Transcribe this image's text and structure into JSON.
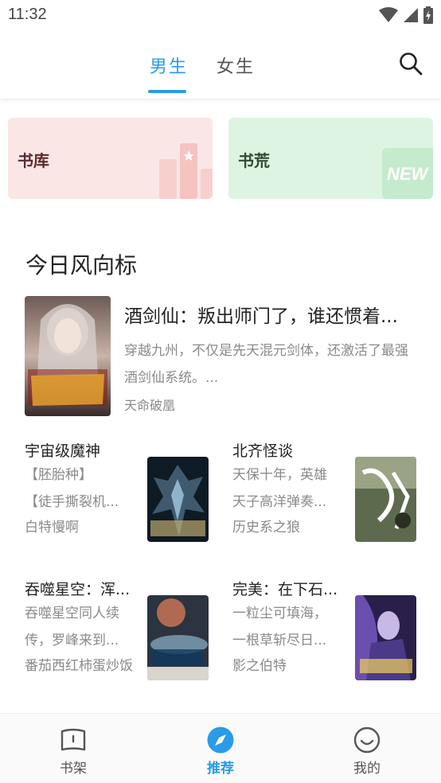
{
  "status": {
    "time": "11:32"
  },
  "nav": {
    "tab_male": "男生",
    "tab_female": "女生"
  },
  "banners": {
    "library": "书库",
    "shortage": "书荒"
  },
  "section": {
    "title": "今日风向标"
  },
  "featured": {
    "title": "酒剑仙：叛出师门了，谁还惯着...",
    "desc": "穿越九州，不仅是先天混元剑体，还激活了最强酒剑仙系统。...",
    "author": "天命破凰"
  },
  "books": [
    {
      "title": "宇宙级魔神",
      "desc1": "【胚胎种】",
      "desc2": "【徒手撕裂机...",
      "author": "白特慢啊"
    },
    {
      "title": "北齐怪谈",
      "desc1": "天保十年，英雄",
      "desc2": "天子高洋弹奏...",
      "author": "历史系之狼"
    },
    {
      "title": "吞噬星空：浑...",
      "desc1": "吞噬星空同人续",
      "desc2": "传，罗峰来到...",
      "author": "番茄西红柿蛋炒饭"
    },
    {
      "title": "完美：在下石...",
      "desc1": "一粒尘可填海，",
      "desc2": "一根草斩尽日...",
      "author": "影之伯特"
    }
  ],
  "bottom_nav": {
    "bookshelf": "书架",
    "recommend": "推荐",
    "mine": "我的"
  },
  "colors": {
    "accent": "#2a9be8"
  },
  "icons": [
    "wifi-icon",
    "signal-icon",
    "battery-icon",
    "search-icon",
    "bookshelf-icon",
    "compass-icon",
    "smile-icon"
  ]
}
